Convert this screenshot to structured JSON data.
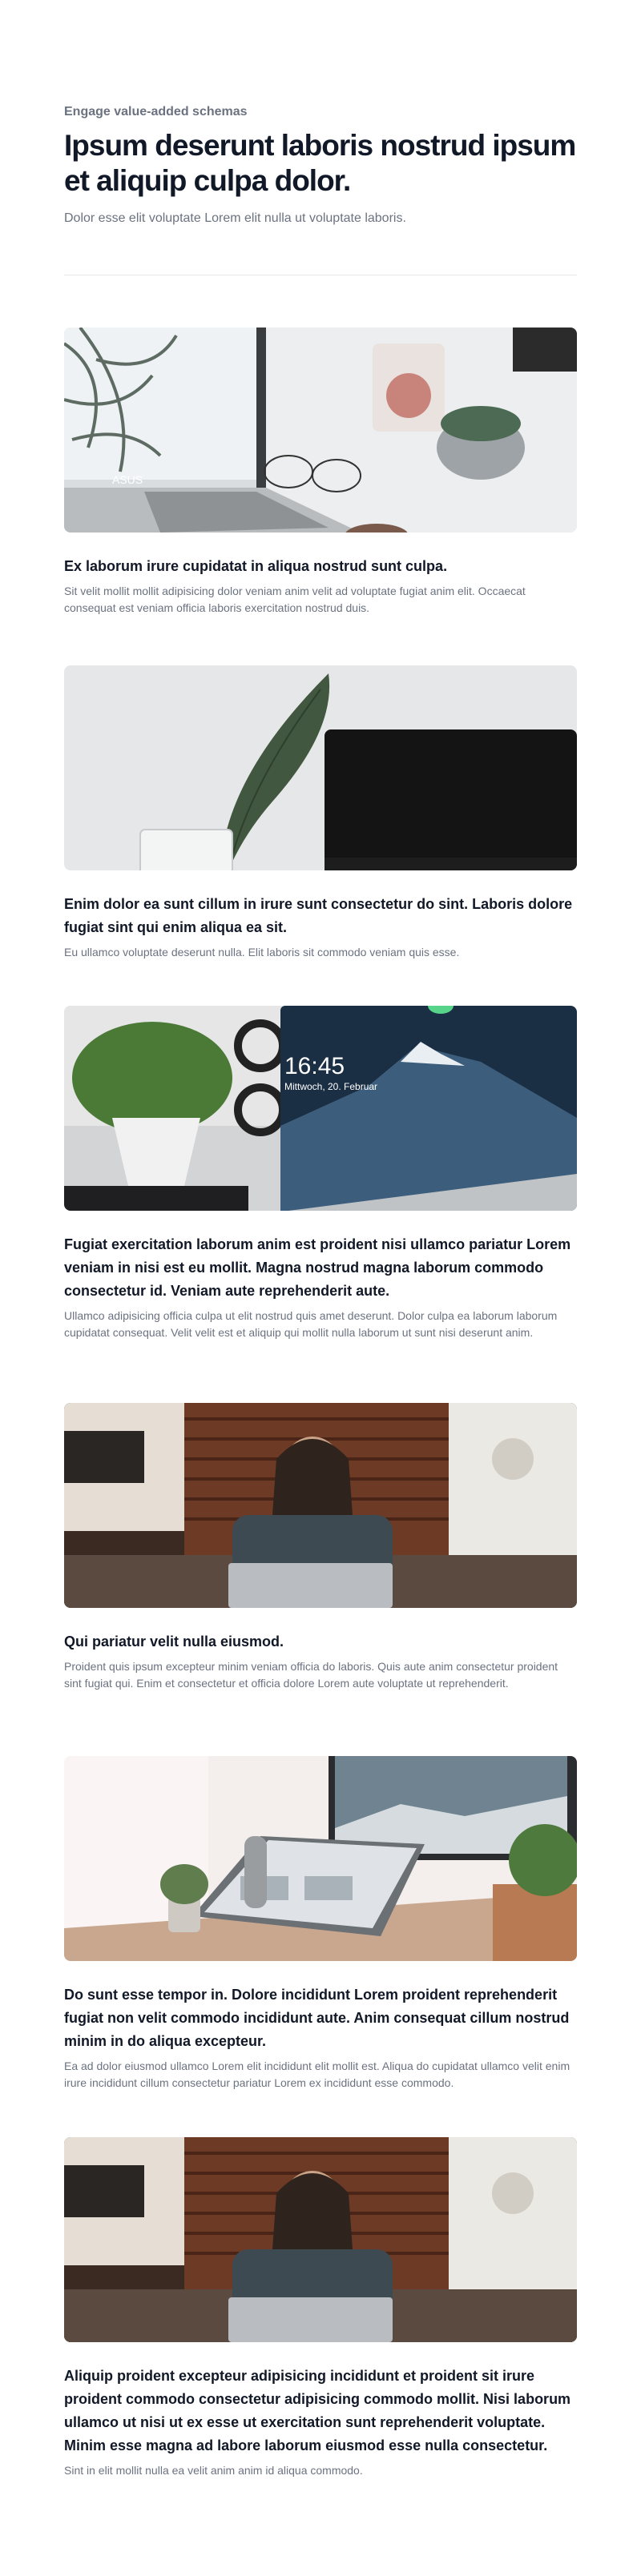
{
  "header": {
    "eyebrow": "Engage value-added schemas",
    "title": "Ipsum deserunt laboris nostrud ipsum et aliquip culpa dolor.",
    "subtitle": "Dolor esse elit voluptate Lorem elit nulla ut voluptate laboris."
  },
  "posts": [
    {
      "image": "laptop-desk-succulent-photo",
      "title": "Ex laborum irure cupidatat in aliqua nostrud sunt culpa.",
      "excerpt": "Sit velit mollit mollit adipisicing dolor veniam anim velit ad voluptate fugiat anim elit. Occaecat consequat est veniam officia laboris exercitation nostrud duis."
    },
    {
      "image": "leaf-vase-monitor-photo",
      "title": "Enim dolor ea sunt cillum in irure sunt consectetur do sint. Laboris dolore fugiat sint qui enim aliqua ea sit.",
      "excerpt": "Eu ullamco voluptate deserunt nulla. Elit laboris sit commodo veniam quis esse."
    },
    {
      "image": "desktop-monitor-plant-photo",
      "title": "Fugiat exercitation laborum anim est proident nisi ullamco pariatur Lorem veniam in nisi est eu mollit. Magna nostrud magna laborum commodo consectetur id. Veniam aute reprehenderit aute.",
      "excerpt": "Ullamco adipisicing officia culpa ut elit nostrud quis amet deserunt. Dolor culpa ea laborum laborum cupidatat consequat. Velit velit est et aliquip qui mollit nulla laborum ut sunt nisi deserunt anim.",
      "screen_time": "16:45",
      "screen_date": "Mittwoch, 20. Februar"
    },
    {
      "image": "man-laptop-cafe-photo",
      "title": "Qui pariatur velit nulla eiusmod.",
      "excerpt": "Proident quis ipsum excepteur minim veniam officia do laboris. Quis aute anim consectetur proident sint fugiat qui. Enim et consectetur et officia dolore Lorem aute voluptate ut reprehenderit."
    },
    {
      "image": "laptop-workspace-photo",
      "title": "Do sunt esse tempor in. Dolore incididunt Lorem proident reprehenderit fugiat non velit commodo incididunt aute. Anim consequat cillum nostrud minim in do aliqua excepteur.",
      "excerpt": "Ea ad dolor eiusmod ullamco Lorem elit incididunt elit mollit est. Aliqua do cupidatat ullamco velit enim irure incididunt cillum consectetur pariatur Lorem ex incididunt esse commodo."
    },
    {
      "image": "man-laptop-cafe-photo",
      "title": "Aliquip proident excepteur adipisicing incididunt et proident sit irure proident commodo consectetur adipisicing commodo mollit. Nisi laborum ullamco ut nisi ut ex esse ut exercitation sunt reprehenderit voluptate. Minim esse magna ad labore laborum eiusmod esse nulla consectetur.",
      "excerpt": "Sint in elit mollit nulla ea velit anim anim id aliqua commodo."
    }
  ]
}
